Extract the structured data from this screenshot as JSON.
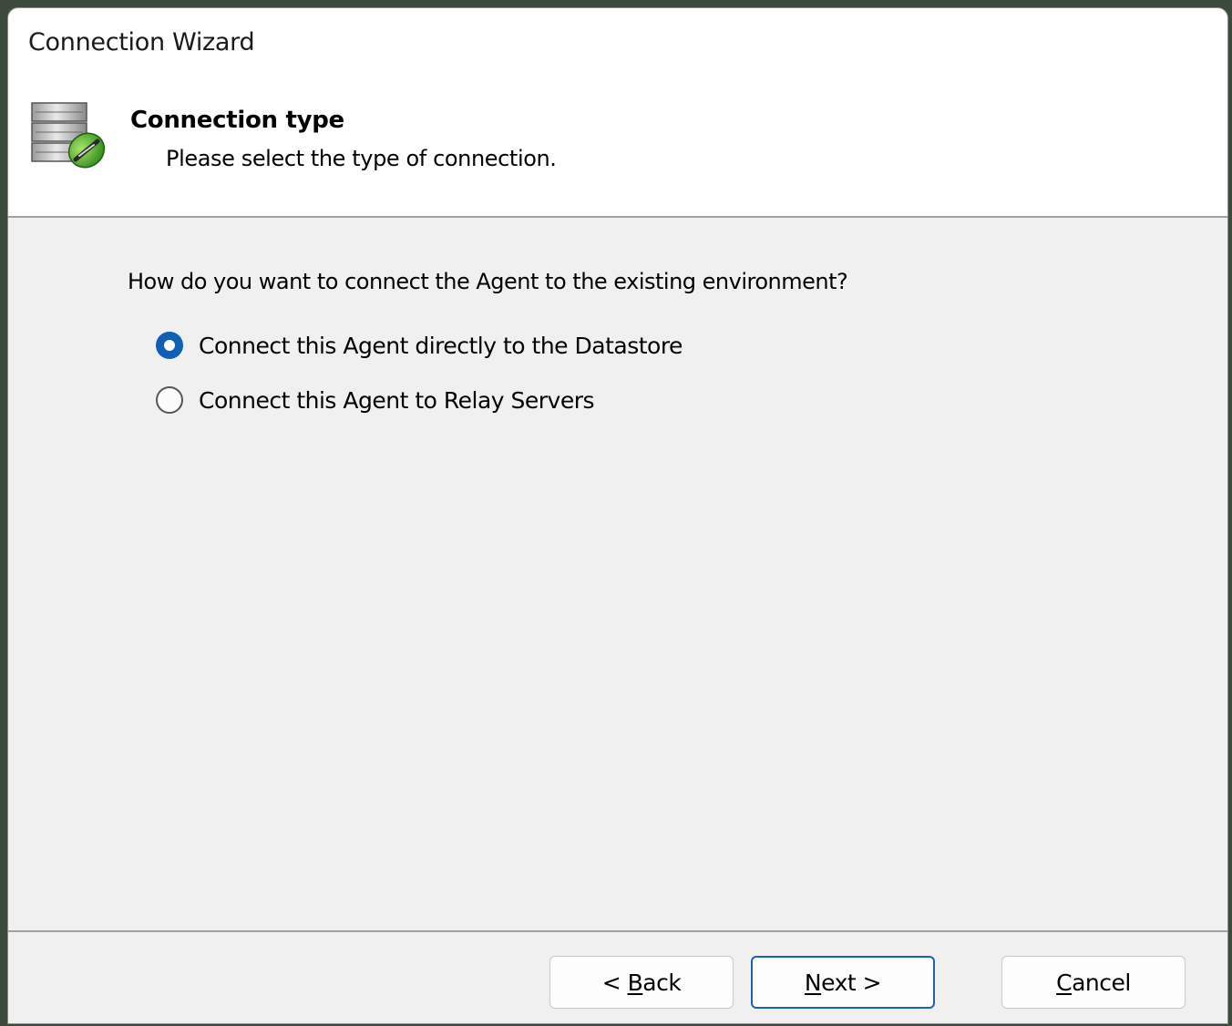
{
  "window": {
    "title": "Connection Wizard"
  },
  "header": {
    "title": "Connection type",
    "subtitle": "Please select the type of connection.",
    "icon": "database-connection-icon"
  },
  "content": {
    "question": "How do you want to connect the Agent to the existing environment?",
    "options": [
      {
        "label": "Connect this Agent directly to the Datastore",
        "selected": true
      },
      {
        "label": "Connect this Agent to Relay Servers",
        "selected": false
      }
    ]
  },
  "footer": {
    "back": {
      "prefix": "< ",
      "mnemonic": "B",
      "rest": "ack"
    },
    "next": {
      "prefix": "",
      "mnemonic": "N",
      "rest": "ext >"
    },
    "cancel": {
      "prefix": "",
      "mnemonic": "C",
      "rest": "ancel"
    }
  },
  "colors": {
    "accent": "#0f5fb5",
    "primary_button_border": "#1a62b8",
    "content_background": "#f0f0f0",
    "header_background": "#ffffff"
  }
}
